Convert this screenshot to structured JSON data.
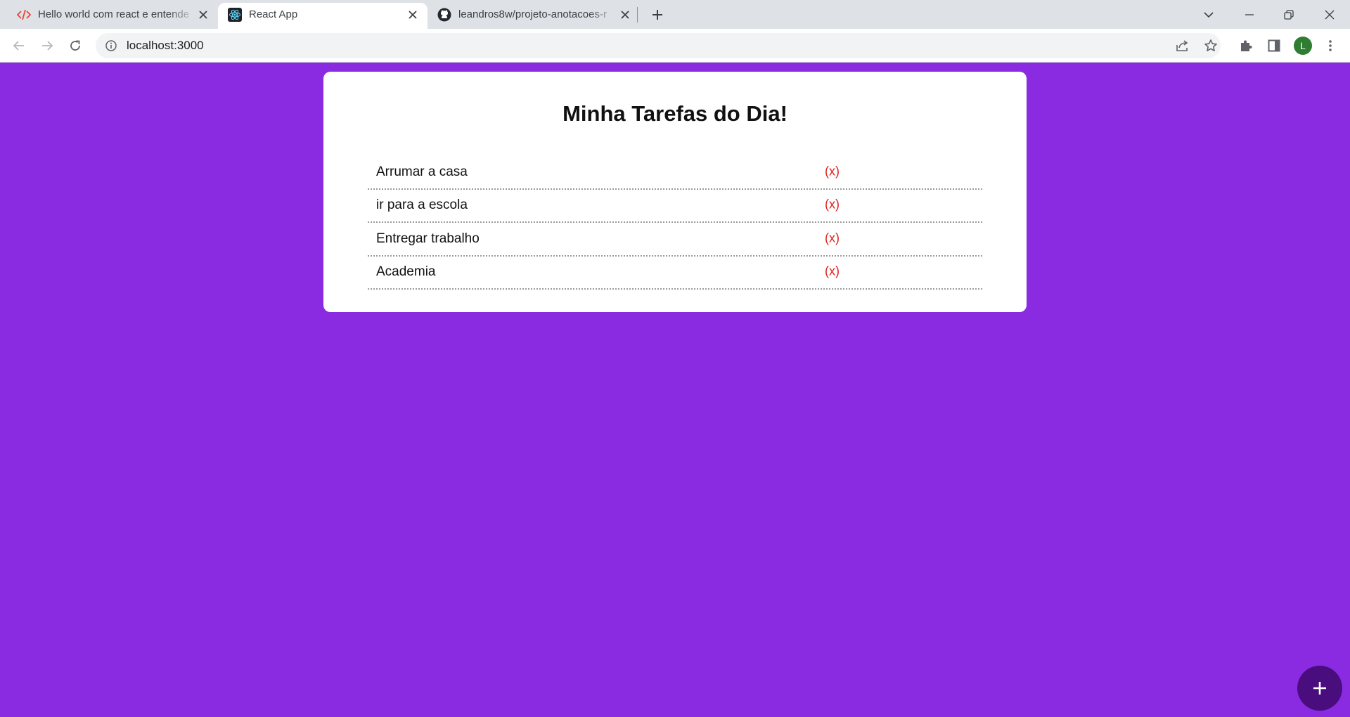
{
  "browser": {
    "tabs": [
      {
        "title": "Hello world com react e entende",
        "icon": "code-brackets-icon",
        "active": false
      },
      {
        "title": "React App",
        "icon": "react-logo-icon",
        "active": true
      },
      {
        "title": "leandros8w/projeto-anotacoes-r",
        "icon": "github-icon",
        "active": false
      }
    ],
    "address": {
      "url": "localhost:3000"
    },
    "profile_initial": "L",
    "colors": {
      "tabstrip": "#dee1e6",
      "toolbar": "#ffffff",
      "omnibox": "#f1f3f4",
      "avatar": "#2e7d32"
    }
  },
  "page": {
    "background": "#8a2be2",
    "title": "Minha Tarefas do Dia!",
    "tasks": [
      {
        "label": "Arrumar a casa",
        "remove": "(x)"
      },
      {
        "label": "ir para a escola",
        "remove": "(x)"
      },
      {
        "label": "Entregar trabalho",
        "remove": "(x)"
      },
      {
        "label": "Academia",
        "remove": "(x)"
      }
    ],
    "remove_color": "#e0201b",
    "fab": {
      "icon": "plus-icon",
      "color": "#4a0d7d"
    }
  }
}
